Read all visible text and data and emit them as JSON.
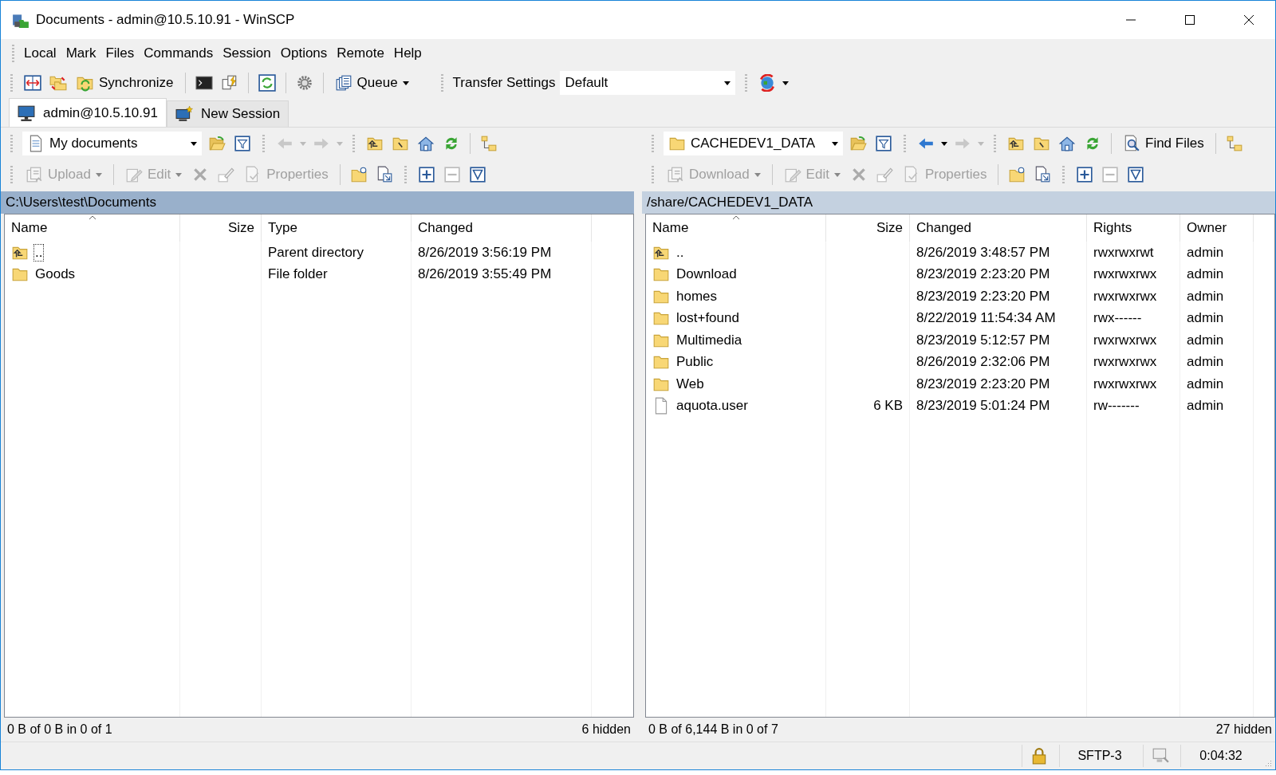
{
  "window": {
    "title": "Documents - admin@10.5.10.91 - WinSCP"
  },
  "menu": [
    "Local",
    "Mark",
    "Files",
    "Commands",
    "Session",
    "Options",
    "Remote",
    "Help"
  ],
  "toolbar": {
    "synchronize": "Synchronize",
    "queue": "Queue",
    "transfer_label": "Transfer Settings",
    "transfer_value": "Default"
  },
  "session_tabs": [
    {
      "label": "admin@10.5.10.91",
      "selected": true,
      "kind": "session"
    },
    {
      "label": "New Session",
      "selected": false,
      "kind": "new"
    }
  ],
  "panels": [
    {
      "active": true,
      "location": "My documents",
      "back_enabled": false,
      "actions": [
        {
          "label": "Upload",
          "disabled": true
        },
        {
          "label": "Edit",
          "disabled": true
        },
        {
          "label": "Properties",
          "disabled": true
        }
      ],
      "path": "C:\\Users\\test\\Documents",
      "columns": [
        {
          "label": "Name",
          "sorted": true
        },
        {
          "label": "Size",
          "sorted": false
        },
        {
          "label": "Type",
          "sorted": false
        },
        {
          "label": "Changed",
          "sorted": false
        }
      ],
      "rows": [
        {
          "kind": "parent",
          "focused": true,
          "cells": [
            "..",
            "",
            "Parent directory",
            "8/26/2019  3:56:19 PM"
          ]
        },
        {
          "kind": "folder",
          "focused": false,
          "cells": [
            "Goods",
            "",
            "File folder",
            "8/26/2019  3:55:49 PM"
          ]
        }
      ],
      "status": {
        "selection": "0 B of 0 B in 0 of 1",
        "hidden": "6 hidden"
      }
    },
    {
      "active": false,
      "location": "CACHEDEV1_DATA",
      "back_enabled": true,
      "find_files": "Find Files",
      "actions": [
        {
          "label": "Download",
          "disabled": true
        },
        {
          "label": "Edit",
          "disabled": true
        },
        {
          "label": "Properties",
          "disabled": true
        }
      ],
      "path": "/share/CACHEDEV1_DATA",
      "columns": [
        {
          "label": "Name",
          "sorted": true
        },
        {
          "label": "Size",
          "sorted": false
        },
        {
          "label": "Changed",
          "sorted": false
        },
        {
          "label": "Rights",
          "sorted": false
        },
        {
          "label": "Owner",
          "sorted": false
        }
      ],
      "rows": [
        {
          "kind": "parent",
          "focused": false,
          "cells": [
            "..",
            "",
            "8/26/2019 3:48:57 PM",
            "rwxrwxrwt",
            "admin"
          ]
        },
        {
          "kind": "folder",
          "focused": false,
          "cells": [
            "Download",
            "",
            "8/23/2019 2:23:20 PM",
            "rwxrwxrwx",
            "admin"
          ]
        },
        {
          "kind": "folder",
          "focused": false,
          "cells": [
            "homes",
            "",
            "8/23/2019 2:23:20 PM",
            "rwxrwxrwx",
            "admin"
          ]
        },
        {
          "kind": "folder",
          "focused": false,
          "cells": [
            "lost+found",
            "",
            "8/22/2019 11:54:34 AM",
            "rwx------",
            "admin"
          ]
        },
        {
          "kind": "folder",
          "focused": false,
          "cells": [
            "Multimedia",
            "",
            "8/23/2019 5:12:57 PM",
            "rwxrwxrwx",
            "admin"
          ]
        },
        {
          "kind": "folder",
          "focused": false,
          "cells": [
            "Public",
            "",
            "8/26/2019 2:32:06 PM",
            "rwxrwxrwx",
            "admin"
          ]
        },
        {
          "kind": "folder",
          "focused": false,
          "cells": [
            "Web",
            "",
            "8/23/2019 2:23:20 PM",
            "rwxrwxrwx",
            "admin"
          ]
        },
        {
          "kind": "file",
          "focused": false,
          "cells": [
            "aquota.user",
            "6 KB",
            "8/23/2019 5:01:24 PM",
            "rw-------",
            "admin"
          ]
        }
      ],
      "status": {
        "selection": "0 B of 6,144 B in 0 of 7",
        "hidden": "27 hidden"
      }
    }
  ],
  "status_bar": {
    "protocol": "SFTP-3",
    "elapsed": "0:04:32"
  }
}
